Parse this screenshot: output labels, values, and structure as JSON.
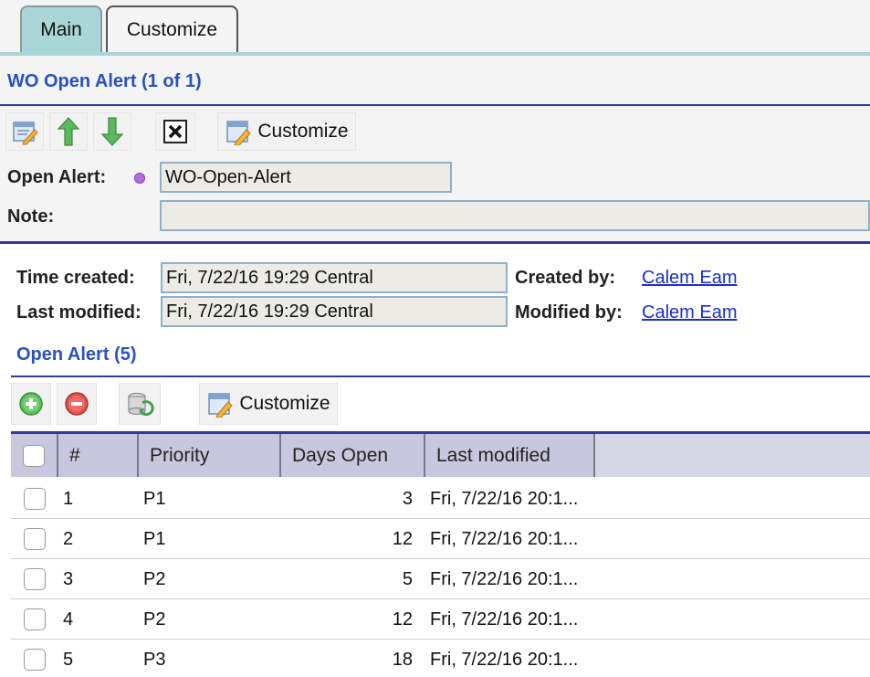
{
  "tabs": [
    {
      "label": "Main",
      "active": true
    },
    {
      "label": "Customize",
      "active": false
    }
  ],
  "header": {
    "title": "WO Open Alert (1 of 1)"
  },
  "toolbar": {
    "customize_label": "Customize"
  },
  "form": {
    "open_alert_label": "Open Alert:",
    "open_alert_value": "WO-Open-Alert",
    "note_label": "Note:",
    "note_value": ""
  },
  "audit": {
    "time_created_label": "Time created:",
    "time_created_value": "Fri, 7/22/16 19:29 Central",
    "last_modified_label": "Last modified:",
    "last_modified_value": "Fri, 7/22/16 19:29 Central",
    "created_by_label": "Created by:",
    "created_by_value": "Calem Eam",
    "modified_by_label": "Modified by:",
    "modified_by_value": "Calem Eam"
  },
  "list": {
    "title": "Open Alert (5)",
    "customize_label": "Customize",
    "columns": [
      "#",
      "Priority",
      "Days Open",
      "Last modified"
    ],
    "rows": [
      {
        "num": "1",
        "priority": "P1",
        "days": "3",
        "modified": "Fri, 7/22/16 20:1..."
      },
      {
        "num": "2",
        "priority": "P1",
        "days": "12",
        "modified": "Fri, 7/22/16 20:1..."
      },
      {
        "num": "3",
        "priority": "P2",
        "days": "5",
        "modified": "Fri, 7/22/16 20:1..."
      },
      {
        "num": "4",
        "priority": "P2",
        "days": "12",
        "modified": "Fri, 7/22/16 20:1..."
      },
      {
        "num": "5",
        "priority": "P3",
        "days": "18",
        "modified": "Fri, 7/22/16 20:1..."
      }
    ]
  },
  "colors": {
    "accent_blue": "#2a52be",
    "tab_active": "#a9d6d6",
    "link": "#1a2fcf",
    "header_bg": "#c9c7dd"
  }
}
